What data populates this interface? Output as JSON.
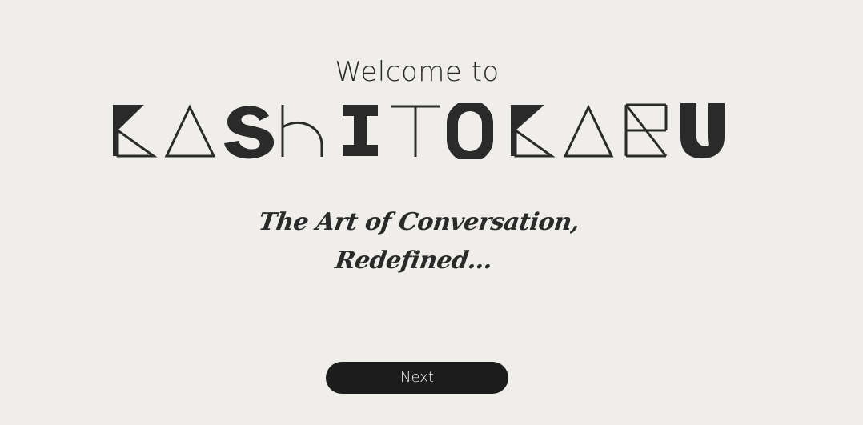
{
  "welcome": {
    "heading": "Welcome to"
  },
  "brand": {
    "logo_text": "KASHITOKARU"
  },
  "tagline": {
    "line1": "The Art of Conversation,",
    "line2": "Redefined..."
  },
  "actions": {
    "next_label": "Next"
  },
  "colors": {
    "background": "#efeeeb",
    "ink": "#2a2a2a",
    "button": "#1c1c1c",
    "button_text": "#f2f2f2"
  }
}
